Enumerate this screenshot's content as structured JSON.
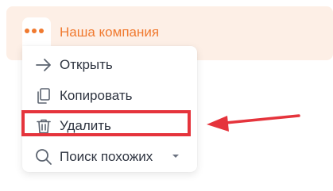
{
  "company": {
    "name": "Наша компания",
    "more_icon": "more-dots-icon"
  },
  "menu": {
    "items": [
      {
        "label": "Открыть",
        "icon": "arrow-right-icon"
      },
      {
        "label": "Копировать",
        "icon": "copy-icon"
      },
      {
        "label": "Удалить",
        "icon": "trash-icon"
      },
      {
        "label": "Поиск похожих",
        "icon": "search-icon",
        "has_dropdown": true
      }
    ]
  },
  "annotation": {
    "highlighted_item": "Удалить",
    "color": "#e5343c"
  },
  "colors": {
    "accent": "#f07a30",
    "bar_background": "#fdefe6",
    "text": "#2e3440",
    "icon": "#5c6470"
  }
}
